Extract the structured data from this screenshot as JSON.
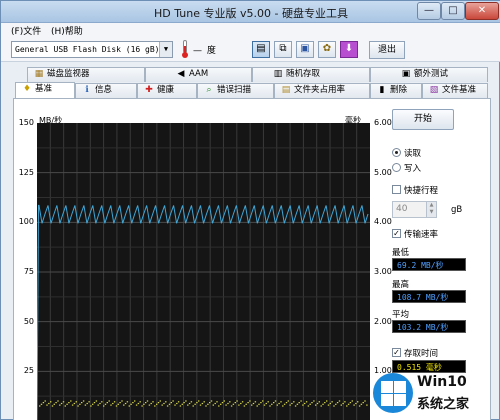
{
  "window": {
    "title": "HD Tune 专业版 v5.00 - 硬盘专业工具",
    "minimize": "—",
    "maximize": "□",
    "close": "✕"
  },
  "menu": [
    "(F)文件",
    "(H)帮助"
  ],
  "toolbar": {
    "drive": "General USB Flash Disk   (16 gB)",
    "temperature": "— 度",
    "exit_label": "退出",
    "buttons": [
      "benchmark-compare",
      "copy",
      "save",
      "settings",
      "download"
    ]
  },
  "tabs_top": [
    {
      "label": "磁盘监视器",
      "icon": "folder-icon"
    },
    {
      "label": "AAM",
      "icon": "speaker-icon"
    },
    {
      "label": "随机存取",
      "icon": "disk-icon"
    },
    {
      "label": "额外测试",
      "icon": "extra-icon"
    }
  ],
  "tabs_bottom": [
    {
      "label": "基准",
      "icon": "bulb-icon",
      "active": true
    },
    {
      "label": "信息",
      "icon": "info-icon"
    },
    {
      "label": "健康",
      "icon": "health-icon"
    },
    {
      "label": "错误扫描",
      "icon": "scan-icon"
    },
    {
      "label": "文件夹占用率",
      "icon": "folder-usage-icon"
    },
    {
      "label": "删除",
      "icon": "trash-icon"
    },
    {
      "label": "文件基准",
      "icon": "file-bench-icon"
    }
  ],
  "side": {
    "start_label": "开始",
    "read_label": "读取",
    "write_label": "写入",
    "mode": "read",
    "short_stroke_label": "快捷行程",
    "short_stroke_checked": false,
    "stroke_value": "40",
    "stroke_unit": "gB",
    "transfer_rate_label": "传输速率",
    "transfer_rate_checked": true,
    "min_label": "最低",
    "min_value": "69.2 MB/秒",
    "max_label": "最高",
    "max_value": "108.7 MB/秒",
    "avg_label": "平均",
    "avg_value": "103.2 MB/秒",
    "access_time_label": "存取时间",
    "access_time_checked": true,
    "access_time_value": "0.515 毫秒"
  },
  "chart_data": {
    "type": "line",
    "y_left_unit": "MB/秒",
    "y_right_unit": "毫秒",
    "y_left_ticks": [
      "150",
      "125",
      "100",
      "75",
      "50",
      "25"
    ],
    "y_right_ticks": [
      "6.00",
      "5.00",
      "4.00",
      "3.00",
      "2.00",
      "1.00"
    ],
    "ylim_left": [
      0,
      150
    ],
    "ylim_right": [
      0,
      6
    ],
    "grid": true,
    "series": [
      {
        "name": "传输速率",
        "color": "#3fa6d6",
        "min": 69.2,
        "max": 108.7,
        "avg": 103.2,
        "low_band": 99,
        "high_band": 108.5
      },
      {
        "name": "存取时间",
        "color": "#d8d84a",
        "avg_ms": 0.515
      }
    ]
  },
  "watermark": {
    "brand": "Win10",
    "sub": "系统之家"
  }
}
